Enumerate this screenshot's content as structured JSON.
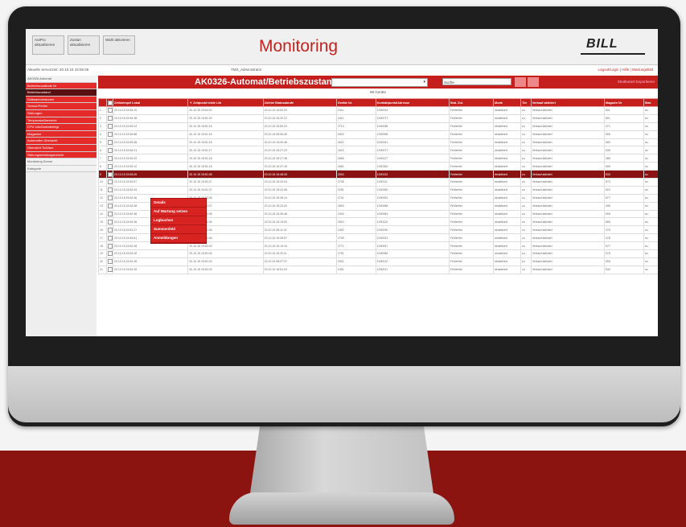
{
  "toolbar": {
    "buttons": [
      {
        "label": "AutPro\naktualisieren"
      },
      {
        "label": "Zustan\naktualisieren"
      },
      {
        "label": "Wahl\naktivieren"
      }
    ]
  },
  "app": {
    "title": "Monitoring",
    "logo": "BILL"
  },
  "infobar": {
    "left": "Aktuelle Servorzeit: 20.10.15 15:56:36",
    "user": "TMS_Administrator",
    "links": "Logout/Login | Hilfe | Wartungsbild"
  },
  "sidebar": {
    "items": [
      {
        "label": "AK0326 Automat",
        "style": "plain"
      },
      {
        "label": "Betriebszustände Nr",
        "style": "red"
      },
      {
        "label": "Betriebszustand",
        "style": "dark"
      },
      {
        "label": "Softwareversionen",
        "style": "red"
      },
      {
        "label": "Sensor/Fehler",
        "style": "red"
      },
      {
        "label": "Störungen",
        "style": "red"
      },
      {
        "label": "Temperaturübersicht",
        "style": "red"
      },
      {
        "label": "CPU Info/Datenbelegt",
        "style": "red"
      },
      {
        "label": "Magazine",
        "style": "red"
      },
      {
        "label": "Automaten Übersicht",
        "style": "red"
      },
      {
        "label": "Übersicht TicWare",
        "style": "red"
      },
      {
        "label": "Störungsmeldungsbericht",
        "style": "red"
      },
      {
        "label": "Monitoring Server",
        "style": "plain"
      },
      {
        "label": "Kategorie",
        "style": "plain"
      }
    ]
  },
  "main": {
    "title": "AK0326-Automat/Betriebszustand",
    "search_placeholder": "Suche",
    "right_link": "Strukturiert Exportieren",
    "count": "98 Geräte",
    "columns": [
      "",
      "",
      "Zeitstempel Lokal",
      "▼ Zeitpunkt letzte Ltb",
      "Zuletzt Statusabrufe",
      "Geräte Nr.",
      "Kontaktpunkt/Adresse",
      "Stat. Zul.",
      "Mode",
      "Tür",
      "Verkauf aktiviert",
      "Magazin Nr",
      "Stat."
    ],
    "rows": [
      [
        "1",
        "",
        "20.10.15 15:54:20",
        "20.10.15 15:54:20",
        "20.10.15 15:54:20",
        "2411",
        "1000019",
        "Fehlerfrei",
        "deaktiviert",
        "zu",
        "Verkauf aktiviert",
        "501",
        "nu"
      ],
      [
        "2",
        "",
        "20.10.15 15:54:38",
        "20.10.15 15:51:20",
        "20.10.15 15:20:12",
        "2411",
        "1000077",
        "Fehlerfrei",
        "deaktiviert",
        "zu",
        "Verkauf aktiviert",
        "801",
        "nu"
      ],
      [
        "3",
        "",
        "20.10.15 15:54:24",
        "20.10.15 15:51:16",
        "20.10.15 15:50:24",
        "2713",
        "1000038",
        "Fehlerfrei",
        "deaktiviert",
        "zu",
        "Verkauf aktiviert",
        "471",
        "nu"
      ],
      [
        "4",
        "",
        "20.10.15 15:53:58",
        "20.10.15 15:51:16",
        "20.10.15 08:06:45",
        "2620",
        "1000098",
        "Fehlerfrei",
        "deaktiviert",
        "zu",
        "Verkauf aktiviert",
        "505",
        "nu"
      ],
      [
        "5",
        "",
        "20.10.15 15:53:48",
        "20.10.15 15:51:18",
        "20.10.15 15:09:48",
        "2622",
        "1000041",
        "Fehlerfrei",
        "deaktiviert",
        "zu",
        "Verkauf aktiviert",
        "980",
        "nu"
      ],
      [
        "6",
        "",
        "20.10.15 15:54:21",
        "20.10.15 15:51:17",
        "20.10.15 15:27:23",
        "2621",
        "1000077",
        "Fehlerfrei",
        "deaktiviert",
        "zu",
        "Verkauf aktiviert",
        "535",
        "nu"
      ],
      [
        "7",
        "",
        "20.10.15 15:54:22",
        "20.10.15 15:51:18",
        "20.10.15 15:27:38",
        "2666",
        "1000117",
        "Fehlerfrei",
        "deaktiviert",
        "zu",
        "Verkauf aktiviert",
        "485",
        "nu"
      ],
      [
        "8",
        "",
        "20.10.15 15:53:12",
        "20.10.15 15:51:18",
        "20.10.15 15:37:18",
        "2661",
        "1000180",
        "Fehlerfrei",
        "deaktiviert",
        "zu",
        "Verkauf aktiviert",
        "590",
        "nu"
      ],
      [
        "9",
        "",
        "20.10.15 15:53:09",
        "20.10.15 15:51:08",
        "20.10.15 15:48:33",
        "2502",
        "1000132",
        "Fehlerfrei",
        "deaktiviert",
        "zu",
        "Verkauf aktiviert",
        "533",
        "nu"
      ],
      [
        "10",
        "",
        "20.10.15 15:52:57",
        "20.10.15 15:51:07",
        "20.10.15 15:20:04",
        "2735",
        "1000111",
        "Fehlerfrei",
        "deaktiviert",
        "zu",
        "Verkauf aktiviert",
        "573",
        "nu"
      ],
      [
        "11",
        "",
        "20.10.15 15:52:43",
        "20.10.15 15:51:07",
        "20.10.15 15:32:08",
        "2251",
        "1000050",
        "Fehlerfrei",
        "deaktiviert",
        "zu",
        "Verkauf aktiviert",
        "522",
        "nu"
      ],
      [
        "12",
        "",
        "20.10.15 15:52:36",
        "20.10.15 15:51:06",
        "20.10.15 15:35:14",
        "2741",
        "1000020",
        "Fehlerfrei",
        "deaktiviert",
        "zu",
        "Verkauf aktiviert",
        "577",
        "nu"
      ],
      [
        "13",
        "",
        "20.10.15 15:52:38",
        "20.10.15 15:51:07",
        "20.10.15 15:23:20",
        "2893",
        "1000068",
        "Fehlerfrei",
        "deaktiviert",
        "zu",
        "Verkauf aktiviert",
        "395",
        "nu"
      ],
      [
        "14",
        "",
        "20.10.15 15:52:38",
        "20.10.15 15:51:08",
        "20.10.15 15:35:48",
        "2903",
        "1000064",
        "Fehlerfrei",
        "deaktiviert",
        "zu",
        "Verkauf aktiviert",
        "505",
        "nu"
      ],
      [
        "15",
        "",
        "20.10.15 15:52:36",
        "20.10.15 15:51:06",
        "20.10.15 15:19:00",
        "2824",
        "1000119",
        "Fehlerfrei",
        "deaktiviert",
        "zu",
        "Verkauf aktiviert",
        "583",
        "nu"
      ],
      [
        "16",
        "",
        "20.10.15 15:51:27",
        "20.10.15 15:51:06",
        "20.10.15 08:11:41",
        "2452",
        "1000030",
        "Fehlerfrei",
        "deaktiviert",
        "zu",
        "Verkauf aktiviert",
        "375",
        "nu"
      ],
      [
        "17",
        "",
        "20.10.15 15:49:51",
        "20.10.15 15:51:06",
        "20.10.15 15:26:57",
        "2795",
        "1000023",
        "Fehlerfrei",
        "deaktiviert",
        "zu",
        "Verkauf aktiviert",
        "378",
        "nu"
      ],
      [
        "18",
        "",
        "20.10.15 15:52:28",
        "20.10.15 15:51:03",
        "20.10.15 15:19:15",
        "2771",
        "1000047",
        "Fehlerfrei",
        "deaktiviert",
        "zu",
        "Verkauf aktiviert",
        "577",
        "nu"
      ],
      [
        "19",
        "",
        "20.10.15 15:52:26",
        "20.10.15 15:51:03",
        "20.10.15 15:20:11",
        "2751",
        "1000056",
        "Fehlerfrei",
        "deaktiviert",
        "zu",
        "Verkauf aktiviert",
        "575",
        "nu"
      ],
      [
        "20",
        "",
        "20.10.15 15:51:26",
        "20.10.15 15:51:03",
        "20.10.15 08:07:47",
        "2501",
        "1000012",
        "Fehlerfrei",
        "deaktiviert",
        "zu",
        "Verkauf aktiviert",
        "505",
        "nu"
      ],
      [
        "21",
        "",
        "20.10.15 15:51:26",
        "20.10.15 15:51:03",
        "20.10.15 15:51:20",
        "2451",
        "1000011",
        "Fehlerfrei",
        "deaktiviert",
        "zu",
        "Verkauf aktiviert",
        "540",
        "nu"
      ]
    ],
    "selected_row": 8
  },
  "context_menu": {
    "items": [
      "Details",
      "Auf Wartung setzen",
      "Logbuchen",
      "Summenfeld",
      "Anmeldungen"
    ]
  },
  "colors": {
    "brand_red": "#c41f1c",
    "floor": "#8c1410"
  }
}
